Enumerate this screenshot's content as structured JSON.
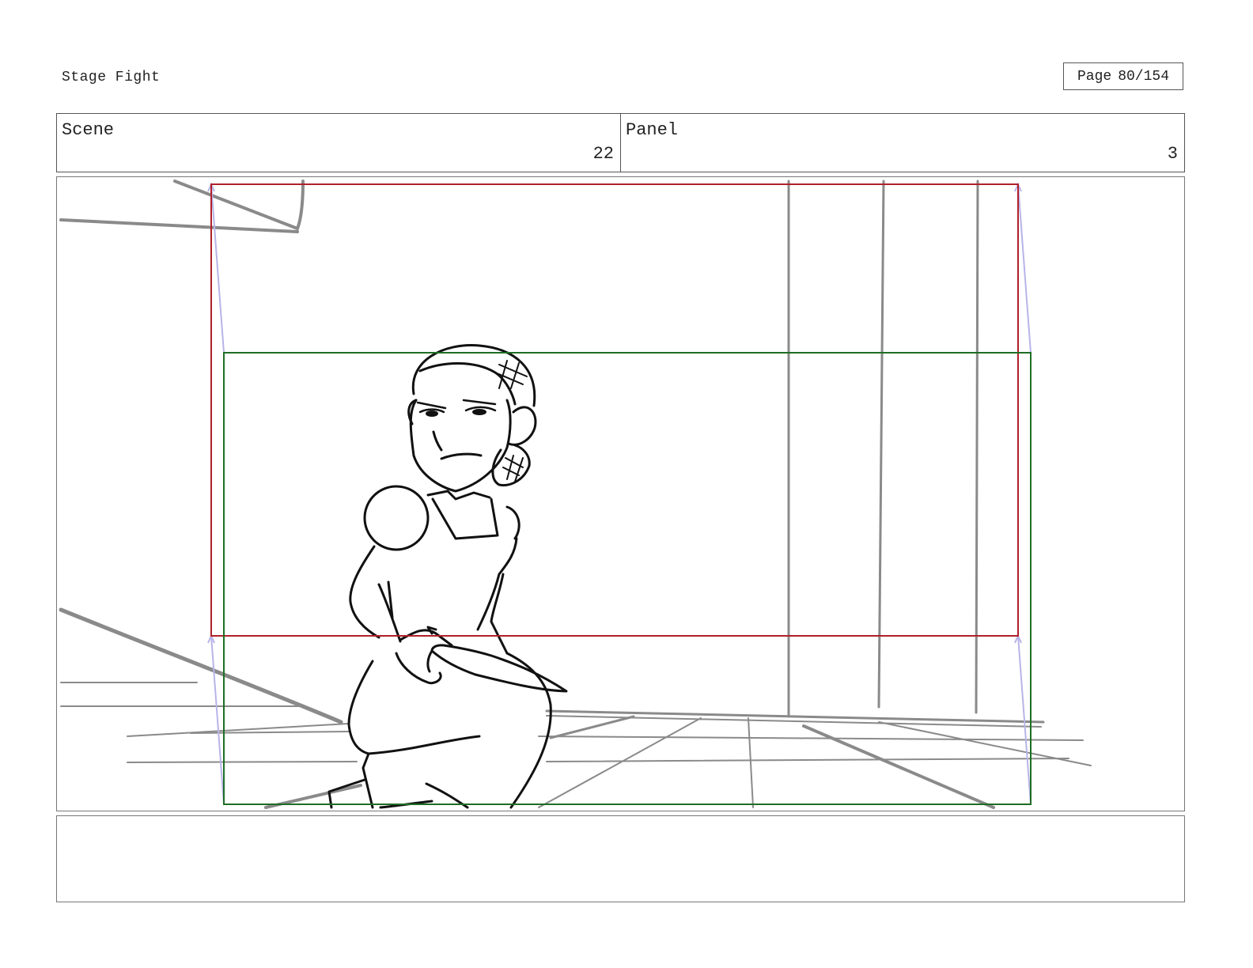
{
  "document": {
    "title": "Stage Fight",
    "page_label": "Page",
    "page_number": "80/154"
  },
  "header": {
    "scene_label": "Scene",
    "scene_number": "22",
    "panel_label": "Panel",
    "panel_number": "3"
  },
  "colors": {
    "camera_frame_start": "#b0202a",
    "camera_frame_end": "#1e6e24",
    "camera_move_path": "#b8b4e8",
    "background_lines": "#8a8a8a",
    "character_lines": "#111111"
  },
  "notes": {
    "text": ""
  }
}
